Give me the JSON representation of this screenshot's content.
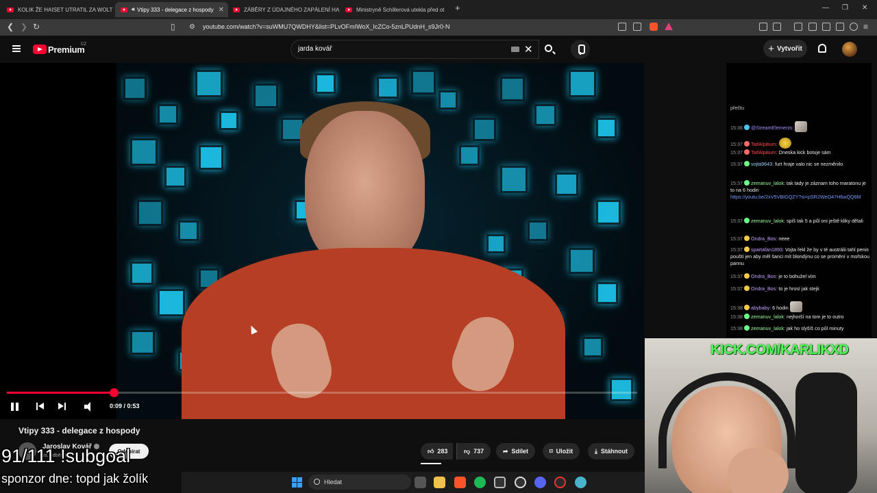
{
  "browser": {
    "tabs": [
      {
        "title": "KOLIK ŽE HAISET UTRATIL ZA WOLT -",
        "active": false
      },
      {
        "title": "Vtipy 333 - delegace z hospody",
        "active": true
      },
      {
        "title": "ZÁBĚRY Z ÚDAJNÉHO ZAPÁLENÍ HA",
        "active": false
      },
      {
        "title": "Ministryně Schillerová utekla před ot",
        "active": false
      }
    ],
    "url": "youtube.com/watch?v=suWMU7QWDHY&list=PLvOFmIWoX_IcZCo-5znLPUdnH_s9Jr0-N",
    "new_tab": "+",
    "close_tab": "✕"
  },
  "youtube": {
    "logo_text": "Premium",
    "logo_region": "CZ",
    "search_value": "jarda kovář",
    "clear_label": "✕",
    "create_label": "Vytvořit",
    "plus": "+"
  },
  "player": {
    "time": "0:09 / 0:53",
    "progress": 0.17
  },
  "video": {
    "title": "Vtipy 333 - delegace z hospody",
    "channel": "Jaroslav Kovář",
    "subscribers": "tis. odběratelů",
    "subscribe_label": "Odebírat",
    "likes": "283",
    "dislikes": "737",
    "share_label": "Sdílet",
    "save_label": "Uložit",
    "download_label": "Stáhnout"
  },
  "chat": {
    "top_fragment": "přečtu",
    "messages": [
      {
        "ts": "15:36",
        "user": "@StreamElements:",
        "text": "",
        "color": "#a78bfa"
      },
      {
        "ts": "15:37",
        "user": "TaifAlpitium:",
        "text": "",
        "color": "#ff4d4d"
      },
      {
        "ts": "15:37",
        "user": "TaifAlpitium:",
        "text": "Dneska kick botuje sám",
        "color": "#ff4d4d"
      },
      {
        "ts": "15:37",
        "user": "vojta9643:",
        "text": "furt hraje valo nic se nezměnilo",
        "color": "#9fd6ff"
      },
      {
        "ts": "15:37",
        "user": "zemanuv_lalok:",
        "text": "tak tady je záznam toho maratonu je to na 6 hodin",
        "link": "https://youtu.be/2xV5VBIGQZY?si=pSR2WeO47H6wQQ6M",
        "color": "#9dff9d"
      },
      {
        "ts": "15:37",
        "user": "zemanuv_lalok:",
        "text": "spíš tak 5 a půl oni ještě kliky dělali",
        "color": "#9dff9d"
      },
      {
        "ts": "15:37",
        "user": "Ondra_Bos:",
        "text": "neee",
        "color": "#c3a3ff"
      },
      {
        "ts": "15:37",
        "user": "spartafan1893:",
        "text": "Vojta řekl že by v té austrálii tahl penis pouští jen aby měl šanci mít blondýnu co se promění v mořskou pannu",
        "color": "#c3a3ff"
      },
      {
        "ts": "15:37",
        "user": "Ondra_Bos:",
        "text": "je to bohužel vím",
        "color": "#c3a3ff"
      },
      {
        "ts": "15:37",
        "user": "Ondra_Bos:",
        "text": "to je hrosí jak stejk",
        "color": "#c3a3ff"
      },
      {
        "ts": "15:38",
        "user": "abybaby:",
        "text": "6 hodin",
        "color": "#c3a3ff"
      },
      {
        "ts": "15:38",
        "user": "zemanuv_lalok:",
        "text": "nejhorší na tom je to outro",
        "color": "#9dff9d"
      },
      {
        "ts": "15:38",
        "user": "zemanuv_lalok:",
        "text": "jak ho slyšíš co půl minuty",
        "color": "#9dff9d"
      }
    ]
  },
  "stream_overlay": {
    "kick_url": "KICK.COM/KARLIKXD",
    "subgoal": "91/111 !subgoal",
    "sponsor": "sponzor dne: topd jak žolík"
  },
  "taskbar": {
    "search_label": "Hledat"
  },
  "colors": {
    "youtube_red": "#ff0033",
    "kick_green": "#52f55a",
    "tile_cyan": "#1ec8f0"
  }
}
